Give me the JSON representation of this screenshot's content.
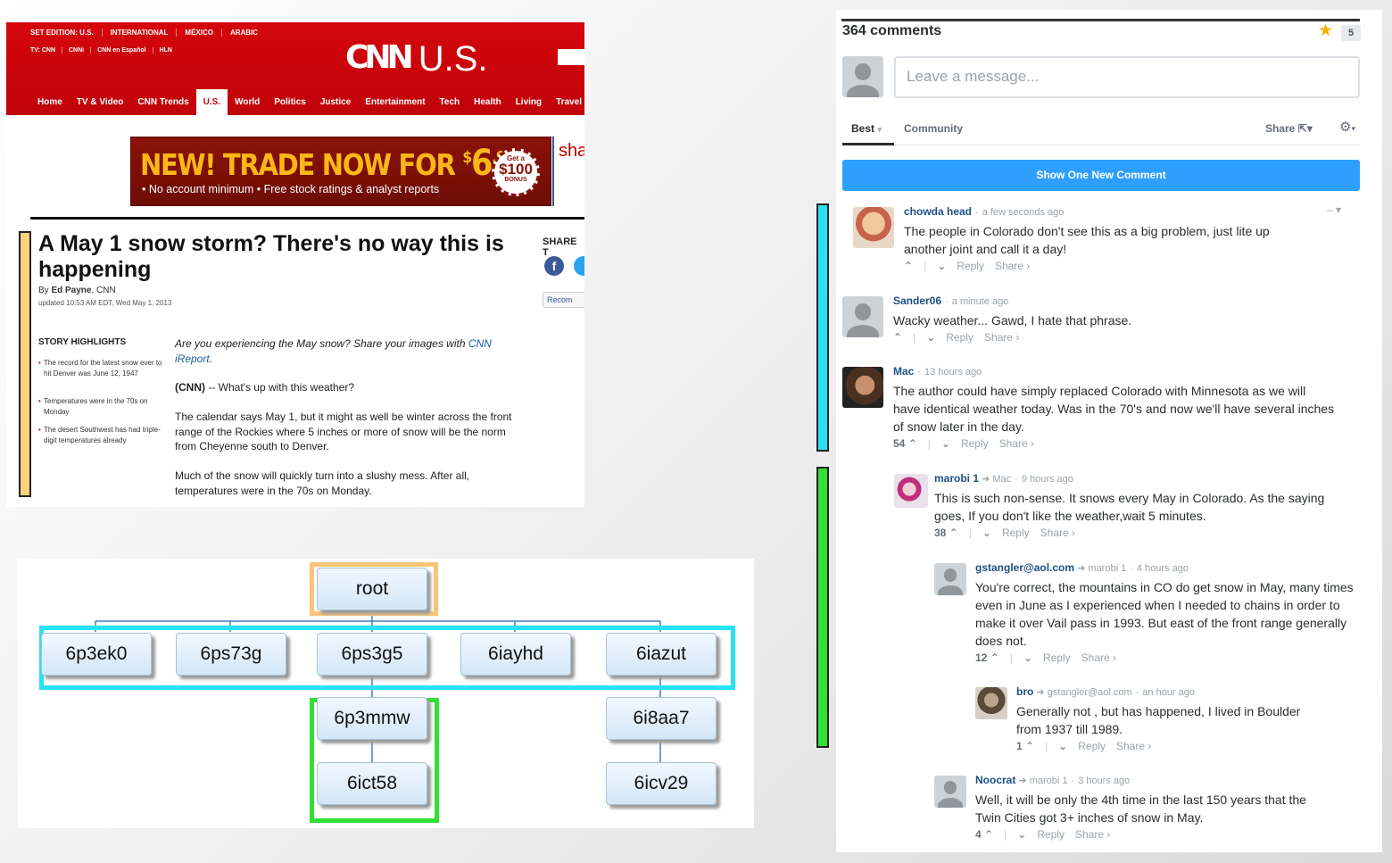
{
  "cnn": {
    "edition_items": [
      "SET EDITION: U.S.",
      "INTERNATIONAL",
      "MÉXICO",
      "ARABIC"
    ],
    "tv_items": [
      "TV: CNN",
      "CNNi",
      "CNN en Español",
      "HLN"
    ],
    "logo_mark": "CNN",
    "logo_suffix": "U.S.",
    "nav": [
      "Home",
      "TV & Video",
      "CNN Trends",
      "U.S.",
      "World",
      "Politics",
      "Justice",
      "Entertainment",
      "Tech",
      "Health",
      "Living",
      "Travel"
    ],
    "nav_active": "U.S.",
    "ad": {
      "headline_prefix": "NEW! TRADE NOW FOR ",
      "price_dollar": "$",
      "price_main": "6",
      "price_cents": ".95",
      "subline": "•  No account minimum   •  Free stock ratings & analyst reports",
      "badge_top": "Get a",
      "badge_amount": "$100",
      "badge_bottom": "BONUS",
      "side_text": "sha"
    },
    "headline": "A May 1 snow storm? There's no way this is happening",
    "byline_prefix": "By ",
    "byline_author": "Ed Payne",
    "byline_suffix": ", CNN",
    "updated": "updated 10:53 AM EDT, Wed May 1, 2013",
    "share_label": "SHARE T",
    "fb_glyph": "f",
    "recommend_label": "Recom",
    "highlights_title": "STORY HIGHLIGHTS",
    "highlights": [
      "The record for the latest snow ever to hit Denver was June 12, 1947",
      "Temperatures were in the 70s on Monday",
      "The desert Southwest has had triple-digit temperatures already"
    ],
    "ireport_text": "Are you experiencing the May snow? Share your images with ",
    "ireport_link": "CNN iReport",
    "ireport_end": ".",
    "p1_lead": "(CNN)",
    "p1": " -- What's up with this weather?",
    "p2": "The calendar says May 1, but it might as well be winter across the front range of the Rockies where 5 inches or more of snow will be the norm from Cheyenne south to Denver.",
    "p3": "Much of the snow will quickly turn into a slushy mess. After all, temperatures were in the 70s on Monday."
  },
  "tree": {
    "root": "root",
    "level1": [
      "6p3ek0",
      "6ps73g",
      "6ps3g5",
      "6iayhd",
      "6iazut"
    ],
    "under_6ps3g5": [
      "6p3mmw",
      "6ict58"
    ],
    "under_6iazut": [
      "6i8aa7",
      "6icv29"
    ]
  },
  "colors": {
    "highlight_orange": "#fbc477",
    "highlight_cyan": "#26e3f3",
    "highlight_green": "#31e035",
    "cnn_red": "#c0040a",
    "disqus_blue": "#2e9fff",
    "author_blue": "#1c4f85"
  },
  "disqus": {
    "count": "364 comments",
    "star_icon": "star-icon",
    "star_count": "5",
    "input_placeholder": "Leave a message...",
    "tab_best": "Best",
    "tab_community": "Community",
    "share": "Share",
    "new_comment_button": "Show One New Comment",
    "collapse": "–  ▾",
    "reply": "Reply",
    "share_link": "Share ›",
    "comments": [
      {
        "author": "chowda head",
        "time": "a few seconds ago",
        "parent": "",
        "text": "The people in Colorado don't see this as a big problem, just lite up another joint and call it a day!",
        "votes": ""
      },
      {
        "author": "Sander06",
        "time": "a minute ago",
        "parent": "",
        "text": "Wacky weather... Gawd, I hate that phrase.",
        "votes": ""
      },
      {
        "author": "Mac",
        "time": "13 hours ago",
        "parent": "",
        "text": "The author could have simply replaced Colorado with Minnesota as we will have identical weather today. Was in the 70's and now we'll have several inches of snow later in the day.",
        "votes": "54"
      },
      {
        "author": "marobi 1",
        "time": "9 hours ago",
        "parent": "Mac",
        "text": "This is such non-sense. It snows every May in Colorado. As the saying goes, If you don't like the weather,wait 5 minutes.",
        "votes": "38"
      },
      {
        "author": "gstangler@aol.com",
        "time": "4 hours ago",
        "parent": "marobi 1",
        "text": "You're correct, the mountains in CO do get snow in May, many times even in June as I experienced when I needed to chains in order to make it over Vail pass in 1993. But east of the front range generally does not.",
        "votes": "12"
      },
      {
        "author": "bro",
        "time": "an hour ago",
        "parent": "gstangler@aol.com",
        "text": "Generally not , but has happened, I lived in Boulder from 1937 till 1989.",
        "votes": "1"
      },
      {
        "author": "Noocrat",
        "time": "3 hours ago",
        "parent": "marobi 1",
        "text": "Well, it will be only the 4th time in the last 150 years that the Twin Cities got 3+ inches of snow in May.",
        "votes": "4"
      }
    ]
  }
}
